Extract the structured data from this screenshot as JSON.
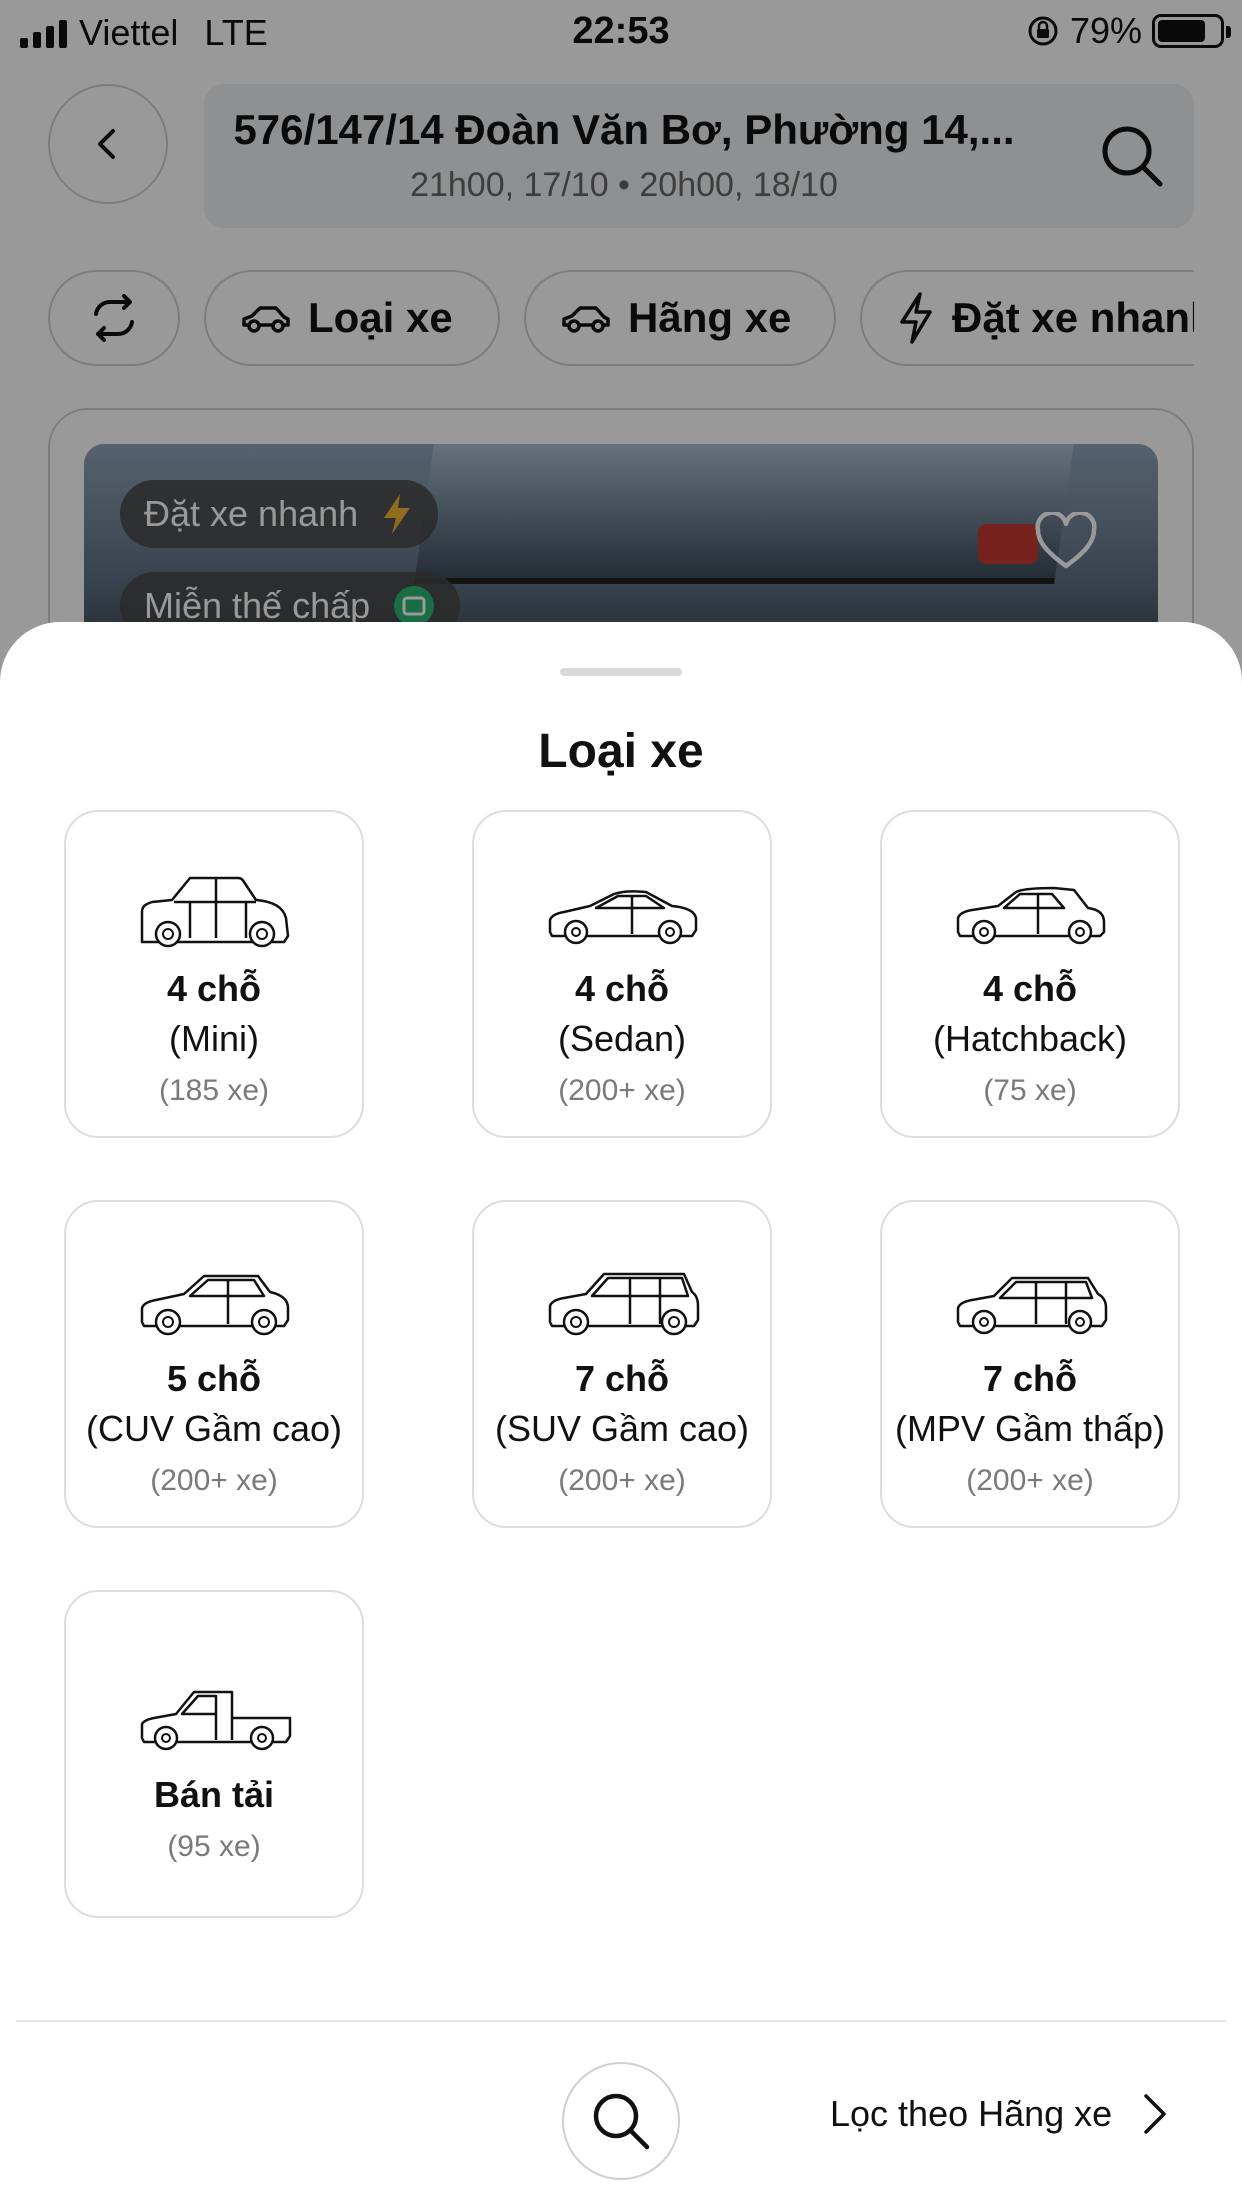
{
  "status": {
    "carrier": "Viettel",
    "network": "LTE",
    "time": "22:53",
    "battery": "79%"
  },
  "header": {
    "address": "576/147/14 Đoàn Văn Bơ, Phường 14,...",
    "dates": "21h00, 17/10 • 20h00, 18/10"
  },
  "filters": {
    "car_type": "Loại xe",
    "brand": "Hãng xe",
    "quick_book": "Đặt xe nhanh"
  },
  "listing": {
    "badge_quick": "Đặt xe nhanh",
    "badge_deposit": "Miễn thế chấp"
  },
  "sheet": {
    "title": "Loại xe",
    "options": [
      {
        "seats": "4 chỗ",
        "type": "(Mini)",
        "count": "(185 xe)",
        "icon": "mini-car-icon"
      },
      {
        "seats": "4 chỗ",
        "type": "(Sedan)",
        "count": "(200+ xe)",
        "icon": "sedan-car-icon"
      },
      {
        "seats": "4 chỗ",
        "type": "(Hatchback)",
        "count": "(75 xe)",
        "icon": "hatchback-car-icon"
      },
      {
        "seats": "5 chỗ",
        "type": "(CUV Gầm cao)",
        "count": "(200+ xe)",
        "icon": "cuv-car-icon"
      },
      {
        "seats": "7 chỗ",
        "type": "(SUV Gầm cao)",
        "count": "(200+ xe)",
        "icon": "suv-car-icon"
      },
      {
        "seats": "7 chỗ",
        "type": "(MPV Gầm thấp)",
        "count": "(200+ xe)",
        "icon": "mpv-car-icon"
      },
      {
        "seats": "Bán tải",
        "count": "(95 xe)",
        "icon": "pickup-truck-icon"
      }
    ],
    "footer_link": "Lọc theo Hãng xe"
  }
}
